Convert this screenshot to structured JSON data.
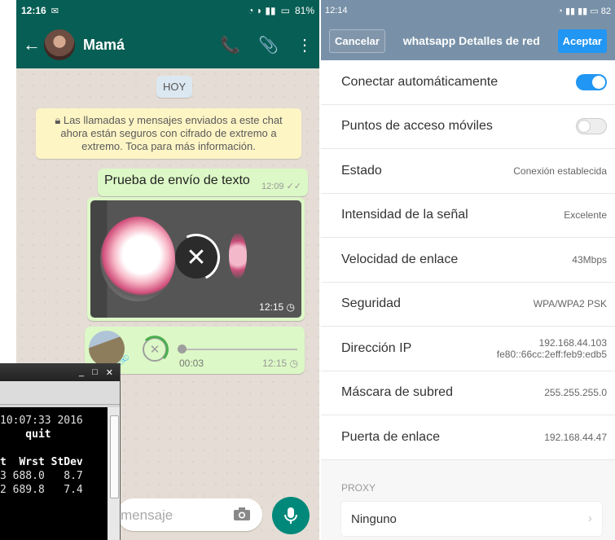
{
  "whatsapp": {
    "status_time": "12:16",
    "battery": "81%",
    "contact_name": "Mamá",
    "back_icon": "arrow-left-icon",
    "date_chip": "HOY",
    "encryption_notice": "Las llamadas y mensajes enviados a este chat ahora están seguros con cifrado de extremo a extremo. Toca para más información.",
    "text_message": {
      "text": "Prueba de envío de texto",
      "time": "12:09"
    },
    "image_message": {
      "time": "12:15"
    },
    "voice_message": {
      "duration": "00:03",
      "time": "12:15"
    },
    "input_placeholder": "mensaje",
    "colors": {
      "header": "#075e54",
      "bubble": "#dcf8c6",
      "mic": "#00897b"
    }
  },
  "terminal": {
    "line1": "10:07:33 2016",
    "line2": "    quit",
    "header": "t  Wrst StDev",
    "row1": "3 688.0   8.7",
    "row2": "2 689.8   7.4"
  },
  "wifi": {
    "status_time": "12:14",
    "battery": "82",
    "cancel_label": "Cancelar",
    "title": "whatsapp Detalles de red",
    "accept_label": "Aceptar",
    "rows": [
      {
        "label": "Conectar automáticamente"
      },
      {
        "label": "Puntos de acceso móviles"
      },
      {
        "label": "Estado",
        "value": "Conexión establecida"
      },
      {
        "label": "Intensidad de la señal",
        "value": "Excelente"
      },
      {
        "label": "Velocidad de enlace",
        "value": "43Mbps"
      },
      {
        "label": "Seguridad",
        "value": "WPA/WPA2 PSK"
      },
      {
        "label": "Dirección IP",
        "value": "192.168.44.103",
        "value2": "fe80::66cc:2eff:feb9:edb5"
      },
      {
        "label": "Máscara de subred",
        "value": "255.255.255.0"
      },
      {
        "label": "Puerta de enlace",
        "value": "192.168.44.47"
      }
    ],
    "auto_connect": true,
    "mobile_hotspots": false,
    "proxy_label": "PROXY",
    "proxy_value": "Ninguno",
    "colors": {
      "bar": "#7891a8",
      "accent": "#2196f3"
    }
  }
}
